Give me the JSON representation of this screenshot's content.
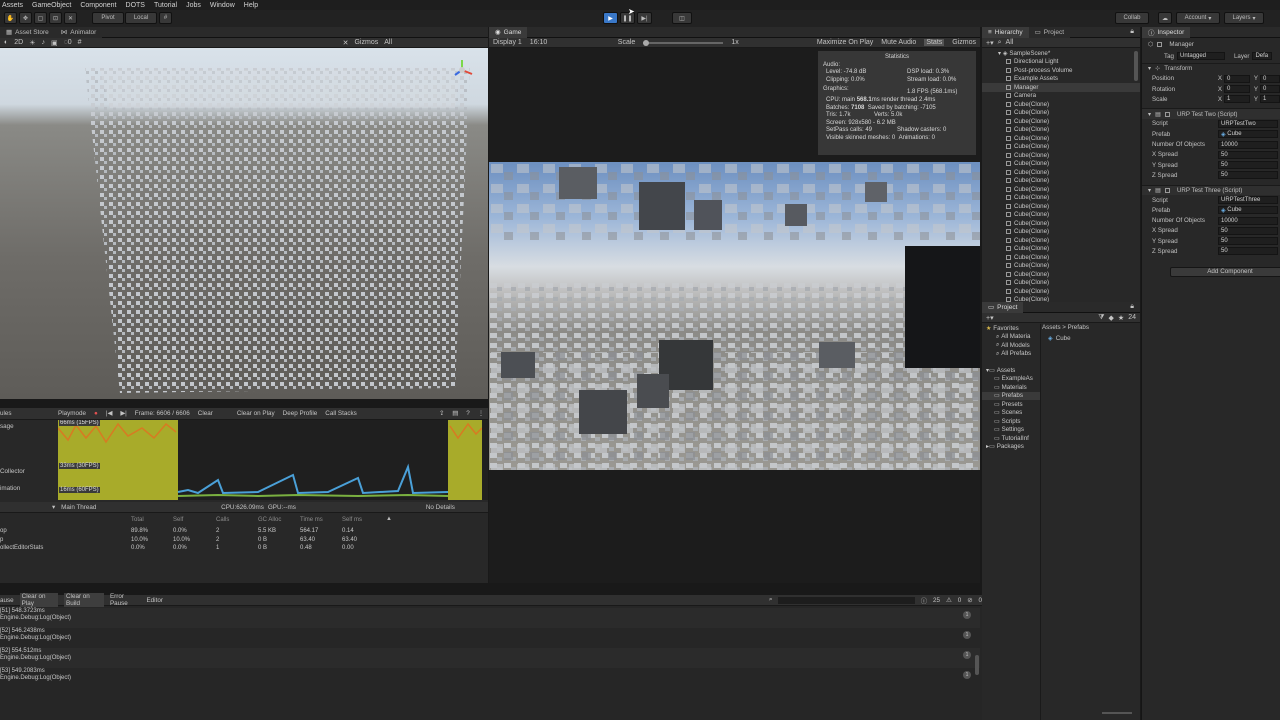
{
  "menu": [
    "Assets",
    "GameObject",
    "Component",
    "DOTS",
    "Tutorial",
    "Jobs",
    "Window",
    "Help"
  ],
  "toolbar": {
    "pivot": "Pivot",
    "local": "Local",
    "collab": "Collab",
    "account": "Account",
    "layers": "Layers"
  },
  "scene": {
    "tabs": [
      "Asset Store",
      "Animator"
    ],
    "mode": "2D",
    "gizmos": "Gizmos",
    "all": "All"
  },
  "game": {
    "tab": "Game",
    "display": "Display 1",
    "aspect": "16:10",
    "scale_label": "Scale",
    "scale_value": "1x",
    "maximize": "Maximize On Play",
    "mute": "Mute Audio",
    "stats": "Stats",
    "gizmos": "Gizmos"
  },
  "statistics": {
    "title": "Statistics",
    "audio_header": "Audio:",
    "level": "Level: -74.8 dB",
    "dsp": "DSP load: 0.3%",
    "clipping": "Clipping: 0.0%",
    "stream": "Stream load: 0.0%",
    "graphics_header": "Graphics:",
    "fps": "1.8 FPS (568.1ms)",
    "cpu_prefix": "CPU: main ",
    "cpu_main": "568.1",
    "cpu_suffix": "ms   render thread 2.4ms",
    "batches_label": "Batches: ",
    "batches_value": "7108",
    "saved": "Saved by batching: -7105",
    "tris": "Tris: 1.7k",
    "verts": "Verts: 5.0k",
    "screen": "Screen: 928x580 - 6.2 MB",
    "setpass": "SetPass calls: 49",
    "shadow": "Shadow casters: 0",
    "skinned": "Visible skinned meshes: 0",
    "animations": "Animations: 0"
  },
  "profiler": {
    "modules": "ules",
    "playmode": "Playmode",
    "frame": "Frame: 6606 / 6606",
    "clear": "Clear",
    "clear_on_play": "Clear on Play",
    "deep_profile": "Deep Profile",
    "call_stacks": "Call Stacks",
    "labels": [
      "66ms (15FPS)",
      "33ms (30FPS)",
      "16ms (60FPS)"
    ],
    "side_labels": [
      "sage",
      "Collector",
      "imation"
    ],
    "thread": "Main Thread",
    "cpu": "CPU:626.09ms",
    "gpu": "GPU:--ms",
    "details": "No Details",
    "columns": [
      "Total",
      "Self",
      "Calls",
      "GC Alloc",
      "Time ms",
      "Self ms"
    ],
    "rows": [
      {
        "name": "op",
        "total": "89.8%",
        "self": "0.0%",
        "calls": "2",
        "gc": "5.5 KB",
        "time": "564.17",
        "selfms": "0.14"
      },
      {
        "name": "p",
        "total": "10.0%",
        "self": "10.0%",
        "calls": "2",
        "gc": "0 B",
        "time": "63.40",
        "selfms": "63.40"
      },
      {
        "name": "ollectEditorStats",
        "total": "0.0%",
        "self": "0.0%",
        "calls": "1",
        "gc": "0 B",
        "time": "0.48",
        "selfms": "0.00"
      }
    ]
  },
  "console": {
    "buttons": [
      "ause",
      "Clear on Play",
      "Clear on Build",
      "Error Pause",
      "Editor"
    ],
    "counts": [
      "25",
      "0",
      "0"
    ],
    "entries": [
      {
        "line1": "[51] 548.3723ms",
        "line2": "Engine.Debug:Log(Object)",
        "count": "1"
      },
      {
        "line1": "[52] 546.2438ms",
        "line2": "Engine.Debug:Log(Object)",
        "count": "1"
      },
      {
        "line1": "[52] 554.512ms",
        "line2": "Engine.Debug:Log(Object)",
        "count": "1"
      },
      {
        "line1": "[53] 549.2083ms",
        "line2": "Engine.Debug:Log(Object)",
        "count": "1"
      }
    ]
  },
  "hierarchy": {
    "tab": "Hierarchy",
    "tab2": "Project",
    "search": "All",
    "scene": "SampleScene*",
    "items": [
      "Directional Light",
      "Post-process Volume",
      "Example Assets",
      "Manager",
      "Camera"
    ],
    "clone_label": "Cube(Clone)",
    "clone_count": 24
  },
  "project": {
    "tab": "Project",
    "favorites": "Favorites",
    "fav_items": [
      "All Materia",
      "All Models",
      "All Prefabs"
    ],
    "assets": "Assets",
    "asset_items": [
      "ExampleAs",
      "Materials",
      "Prefabs",
      "Presets",
      "Scenes",
      "Scripts",
      "Settings",
      "TutorialInf"
    ],
    "packages": "Packages",
    "breadcrumb": "Assets > Prefabs",
    "files": [
      "Cube"
    ],
    "count": "24"
  },
  "inspector": {
    "tab": "Inspector",
    "object": "Manager",
    "tag_label": "Tag",
    "tag": "Untagged",
    "layer_label": "Layer",
    "layer": "Defa",
    "transform": "Transform",
    "position": "Position",
    "rotation": "Rotation",
    "scale": "Scale",
    "x": "X",
    "y": "Y",
    "pos": [
      "0",
      "0"
    ],
    "rot": [
      "0",
      "0"
    ],
    "scl": [
      "1",
      "1"
    ],
    "comp1": {
      "title": "URP Test Two (Script)",
      "script_label": "Script",
      "script": "URPTestTwo",
      "prefab_label": "Prefab",
      "prefab": "Cube",
      "num_label": "Number Of Objects",
      "num": "10000",
      "xs_label": "X Spread",
      "xs": "50",
      "ys_label": "Y Spread",
      "ys": "50",
      "zs_label": "Z Spread",
      "zs": "50"
    },
    "comp2": {
      "title": "URP Test Three (Script)",
      "script_label": "Script",
      "script": "URPTestThree",
      "prefab_label": "Prefab",
      "prefab": "Cube",
      "num_label": "Number Of Objects",
      "num": "10000",
      "xs_label": "X Spread",
      "xs": "50",
      "ys_label": "Y Spread",
      "ys": "50",
      "zs_label": "Z Spread",
      "zs": "50"
    },
    "add_component": "Add Component"
  }
}
